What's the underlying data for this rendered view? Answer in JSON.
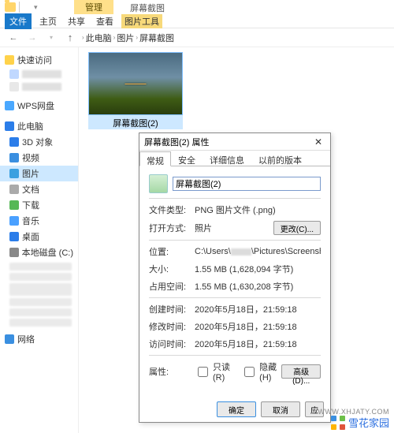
{
  "ribbon": {
    "tab_highlight": "管理",
    "window_title": "屏幕截图",
    "menu": {
      "file": "文件",
      "home": "主页",
      "share": "共享",
      "view": "查看",
      "tool": "图片工具"
    }
  },
  "nav": {
    "crumb1": "此电脑",
    "crumb2": "图片",
    "crumb3": "屏幕截图"
  },
  "sidebar": {
    "quick": "快速访问",
    "wps": "WPS网盘",
    "pc": "此电脑",
    "obj3d": "3D 对象",
    "video": "视频",
    "pic": "图片",
    "doc": "文档",
    "down": "下载",
    "music": "音乐",
    "desk": "桌面",
    "disk": "本地磁盘 (C:)",
    "net": "网络"
  },
  "thumb": {
    "label": "屏幕截图(2)"
  },
  "dlg": {
    "title": "屏幕截图(2) 属性",
    "tabs": {
      "general": "常规",
      "security": "安全",
      "details": "详细信息",
      "prev": "以前的版本"
    },
    "filename_value": "屏幕截图(2)",
    "rows": {
      "type_l": "文件类型:",
      "type_v": "PNG 图片文件 (.png)",
      "open_l": "打开方式:",
      "open_v": "照片",
      "change_btn": "更改(C)...",
      "loc_l": "位置:",
      "loc_v_prefix": "C:\\Users\\",
      "loc_v_suffix": "\\Pictures\\Screenshots",
      "size_l": "大小:",
      "size_v": "1.55 MB (1,628,094 字节)",
      "disk_l": "占用空间:",
      "disk_v": "1.55 MB (1,630,208 字节)",
      "ctime_l": "创建时间:",
      "ctime_v": "2020年5月18日，21:59:18",
      "mtime_l": "修改时间:",
      "mtime_v": "2020年5月18日，21:59:18",
      "atime_l": "访问时间:",
      "atime_v": "2020年5月18日，21:59:18",
      "attr_l": "属性:",
      "readonly": "只读(R)",
      "hidden": "隐藏(H)",
      "adv_btn": "高级(D)..."
    },
    "footer": {
      "ok": "确定",
      "cancel": "取消",
      "apply": "应"
    }
  },
  "watermark": {
    "text": "雪花家园",
    "url": "WWW.XHJATY.COM"
  }
}
